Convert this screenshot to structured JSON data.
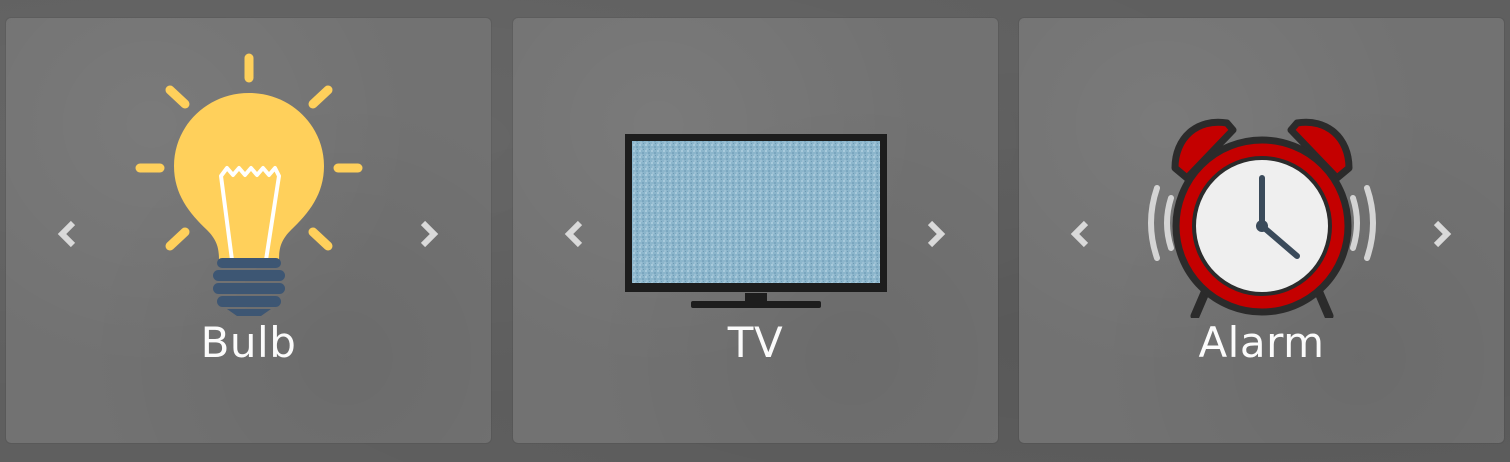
{
  "devices": [
    {
      "label": "Bulb",
      "icon": "lightbulb-icon"
    },
    {
      "label": "TV",
      "icon": "television-icon"
    },
    {
      "label": "Alarm",
      "icon": "alarm-clock-icon"
    }
  ],
  "nav_icons": {
    "prev": "chevron-left-icon",
    "next": "chevron-right-icon"
  },
  "colors": {
    "background": "#5f5f5f",
    "card": "#727272",
    "label_text": "#fbfbfb",
    "chevron": "#d9d9d9",
    "bulb_yellow": "#ffd05b",
    "bulb_base": "#3d5673",
    "tv_screen": "#8cb6cc",
    "alarm_red": "#c40000"
  }
}
